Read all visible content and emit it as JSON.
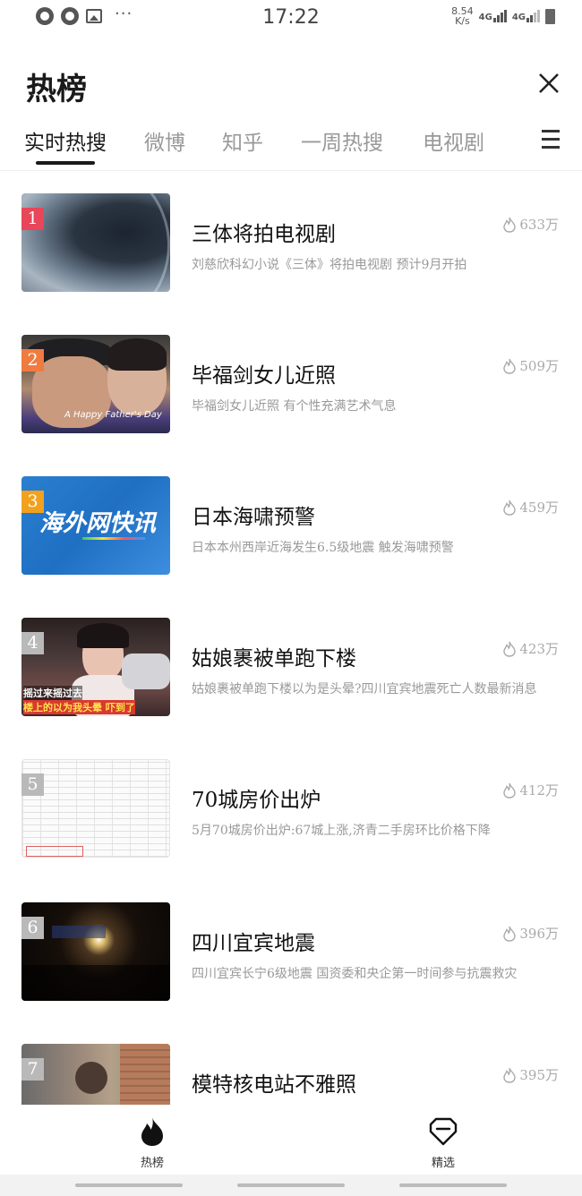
{
  "status_bar": {
    "time": "17:22",
    "speed_value": "8.54",
    "speed_unit": "K/s",
    "net1": "4G",
    "net2": "4G"
  },
  "header": {
    "title": "热榜"
  },
  "tabs": [
    {
      "label": "实时热搜",
      "active": true
    },
    {
      "label": "微博",
      "active": false
    },
    {
      "label": "知乎",
      "active": false
    },
    {
      "label": "一周热搜",
      "active": false
    },
    {
      "label": "电视剧",
      "active": false
    }
  ],
  "items": [
    {
      "rank": "1",
      "rank_color": "#e8465a",
      "title": "三体将拍电视剧",
      "desc": "刘慈欣科幻小说《三体》将拍电视剧 预计9月开拍",
      "heat": "633万"
    },
    {
      "rank": "2",
      "rank_color": "#f07b3f",
      "title": "毕福剑女儿近照",
      "desc": "毕福剑女儿近照 有个性充满艺术气息",
      "heat": "509万",
      "thumb_caption": "A Happy Father's Day"
    },
    {
      "rank": "3",
      "rank_color": "#f2a11d",
      "title": "日本海啸预警",
      "desc": "日本本州西岸近海发生6.5级地震 触发海啸预警",
      "heat": "459万",
      "thumb_caption": "海外网快讯"
    },
    {
      "rank": "4",
      "rank_color": "#b9b9b9",
      "title": "姑娘裹被单跑下楼",
      "desc": "姑娘裹被单跑下楼以为是头晕?四川宜宾地震死亡人数最新消息",
      "heat": "423万",
      "thumb_caption_1": "摇过来摇过去",
      "thumb_caption_2": "楼上的以为我头晕 吓到了"
    },
    {
      "rank": "5",
      "rank_color": "#b9b9b9",
      "title": "70城房价出炉",
      "desc": "5月70城房价出炉:67城上涨,济青二手房环比价格下降",
      "heat": "412万"
    },
    {
      "rank": "6",
      "rank_color": "#b9b9b9",
      "title": "四川宜宾地震",
      "desc": "四川宜宾长宁6级地震 国资委和央企第一时间参与抗震救灾",
      "heat": "396万"
    },
    {
      "rank": "7",
      "rank_color": "#b9b9b9",
      "title": "模特核电站不雅照",
      "desc": "",
      "heat": "395万"
    }
  ],
  "bottom_nav": [
    {
      "label": "热榜",
      "icon": "flame-icon",
      "active": true
    },
    {
      "label": "精选",
      "icon": "gem-icon",
      "active": false
    }
  ]
}
